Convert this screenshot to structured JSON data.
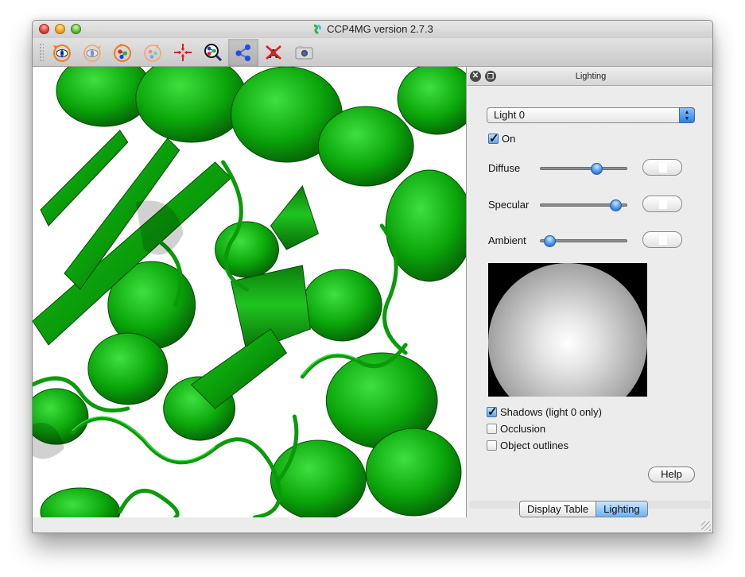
{
  "window": {
    "title": "CCP4MG version 2.7.3",
    "app_icon": "ccp4mg-logo-icon"
  },
  "toolbar": {
    "buttons": [
      {
        "name": "rotate-view-icon",
        "tooltip_semantic": "rotate view",
        "active": false
      },
      {
        "name": "rotate-view-disabled-icon",
        "tooltip_semantic": "rotate view (secondary)",
        "active": false
      },
      {
        "name": "rotate-molecule-icon",
        "tooltip_semantic": "rotate molecule",
        "active": false
      },
      {
        "name": "rotate-molecule-disabled-icon",
        "tooltip_semantic": "rotate molecule (secondary)",
        "active": false
      },
      {
        "name": "centre-on-icon",
        "tooltip_semantic": "centre",
        "active": false
      },
      {
        "name": "zoom-molecule-icon",
        "tooltip_semantic": "zoom",
        "active": false
      },
      {
        "name": "select-atoms-icon",
        "tooltip_semantic": "pick atoms",
        "active": true
      },
      {
        "name": "clear-labels-icon",
        "tooltip_semantic": "clear labels",
        "active": false
      },
      {
        "name": "camera-icon",
        "tooltip_semantic": "screenshot",
        "active": false
      }
    ]
  },
  "viewer": {
    "description": "3D ribbon cartoon of a protein structure",
    "ribbon_color": "#0aa80a",
    "background_color": "#ffffff"
  },
  "lighting_panel": {
    "title": "Lighting",
    "light_select": {
      "value": "Light 0"
    },
    "on_checkbox": {
      "label": "On",
      "checked": true
    },
    "sliders": [
      {
        "label": "Diffuse",
        "value_fraction": 0.65
      },
      {
        "label": "Specular",
        "value_fraction": 0.87
      },
      {
        "label": "Ambient",
        "value_fraction": 0.1
      }
    ],
    "options": [
      {
        "label": "Shadows (light 0 only)",
        "checked": true
      },
      {
        "label": "Occlusion",
        "checked": false
      },
      {
        "label": "Object outlines",
        "checked": false
      }
    ],
    "help_label": "Help"
  },
  "tabs": [
    {
      "label": "Display Table",
      "active": false
    },
    {
      "label": "Lighting",
      "active": true
    }
  ]
}
